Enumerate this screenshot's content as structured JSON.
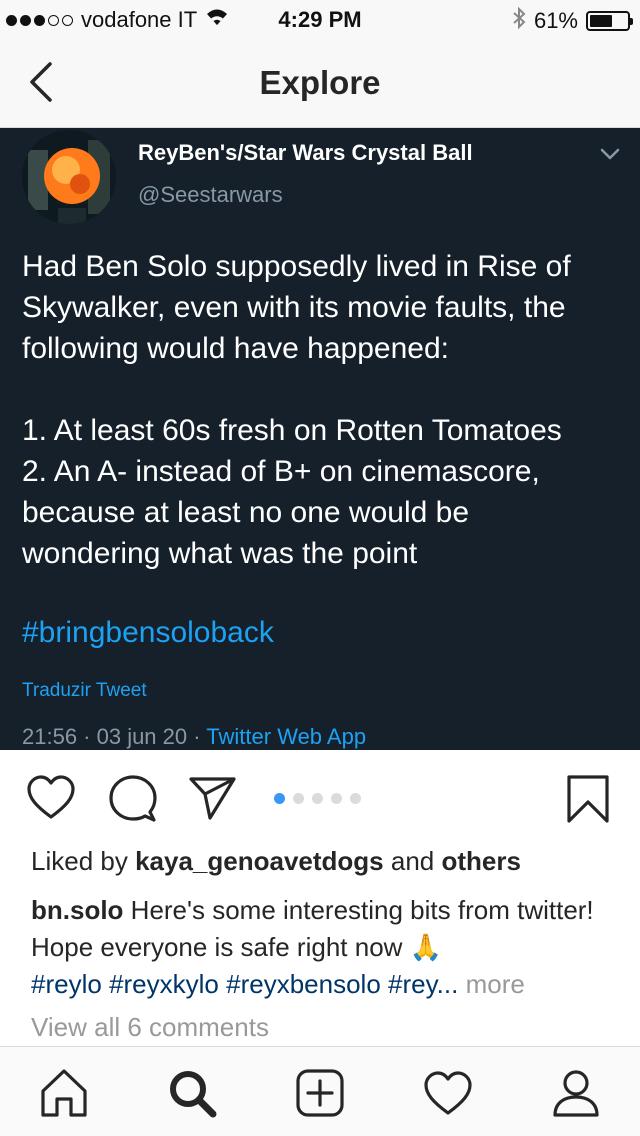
{
  "status_bar": {
    "carrier": "vodafone IT",
    "time": "4:29 PM",
    "battery": "61%",
    "battery_level": 0.61,
    "signal_bars_filled": 3,
    "signal_bars_total": 5
  },
  "nav": {
    "title": "Explore",
    "back_icon": "chevron-left-icon"
  },
  "tweet": {
    "display_name": "ReyBen's/Star Wars Crystal Ball",
    "handle": "@Seestarwars",
    "body_lines": [
      "Had Ben Solo supposedly lived in Rise of",
      "Skywalker, even with its movie faults, the",
      "following would have happened:",
      "",
      "1. At least 60s fresh on Rotten Tomatoes",
      "2.  An A- instead of B+ on cinemascore,",
      "because at least no one would be",
      "wondering what was the point"
    ],
    "hashtag": "#bringbensoloback",
    "translate_label": "Traduzir Tweet",
    "timestamp": "21:56 · 03 jun 20 · ",
    "source_app": "Twitter Web App",
    "colors": {
      "background": "#15202b",
      "link": "#1da1f2",
      "muted": "#8899a6"
    }
  },
  "post_actions": {
    "like_icon": "heart-icon",
    "comment_icon": "comment-icon",
    "share_icon": "send-icon",
    "save_icon": "bookmark-icon",
    "carousel_count": 5,
    "carousel_active_index": 0
  },
  "likes": {
    "prefix": "Liked by ",
    "user": "kaya_genoavetdogs",
    "joiner": " and ",
    "others": "others"
  },
  "caption": {
    "username": "bn.solo",
    "text": " Here's some interesting bits from twitter! Hope everyone is safe right now ",
    "emoji": "🙏",
    "hashtags": [
      "#reylo",
      "#reyxkylo",
      "#reyxbensolo"
    ],
    "truncated_tag": "#rey...",
    "more_label": "more"
  },
  "comments": {
    "view_all_label": "View all 6 comments"
  },
  "tab_bar": {
    "items": [
      "home-icon",
      "search-icon",
      "new-post-icon",
      "activity-heart-icon",
      "profile-icon"
    ],
    "active_index": 1
  }
}
